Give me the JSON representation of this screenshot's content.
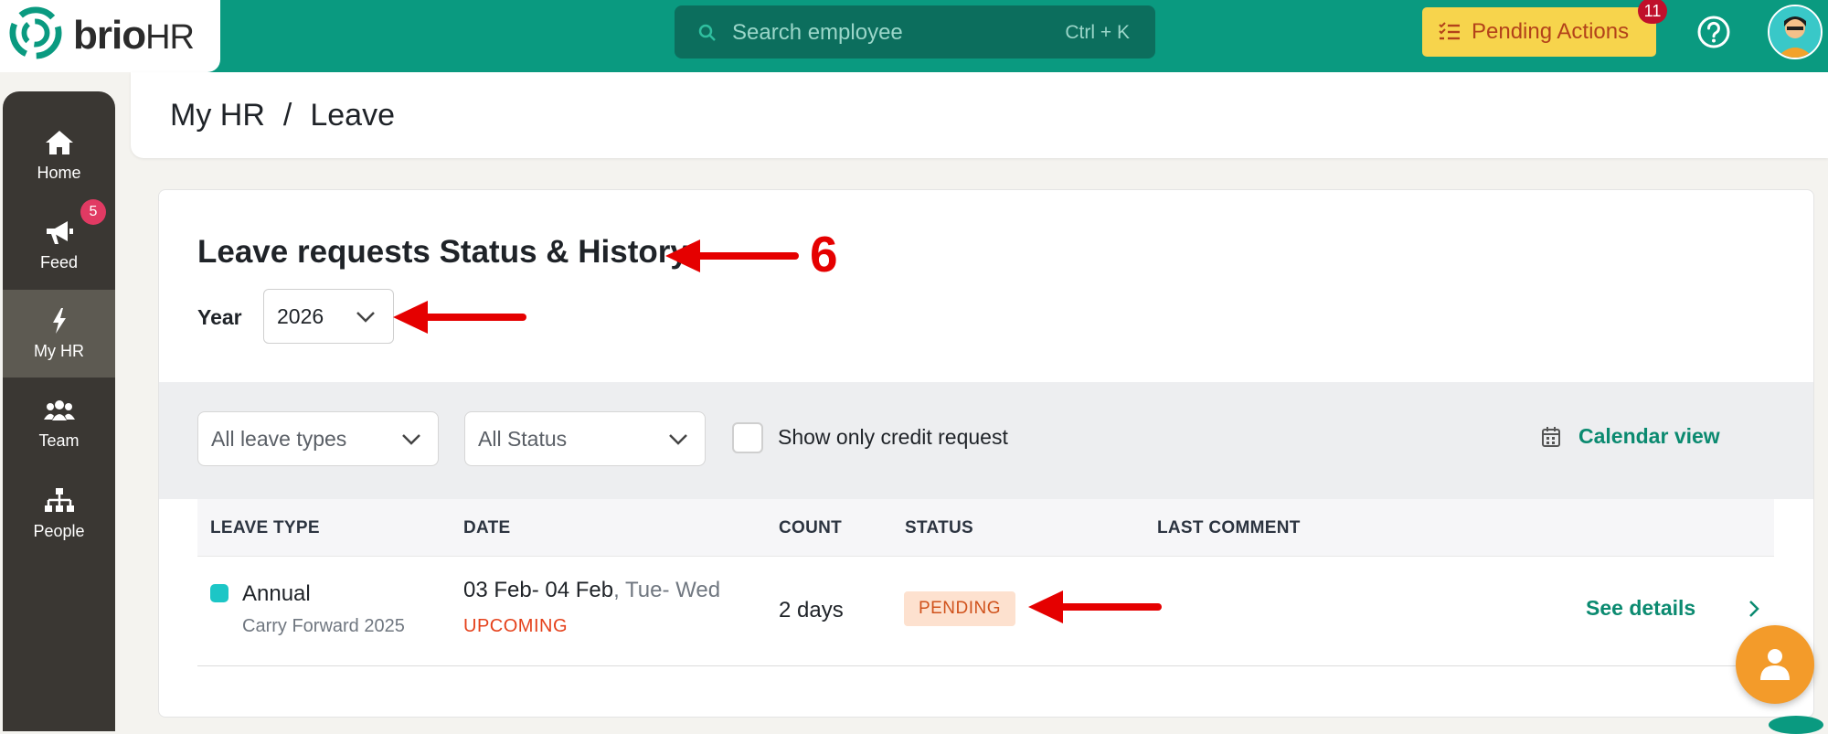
{
  "brand": {
    "name": "brio",
    "suffix": "HR"
  },
  "search": {
    "placeholder": "Search employee",
    "shortcut": "Ctrl + K"
  },
  "pending_actions": {
    "label": "Pending Actions",
    "count": "11"
  },
  "sidebar": {
    "items": [
      {
        "label": "Home",
        "icon": "home-icon"
      },
      {
        "label": "Feed",
        "icon": "megaphone-icon",
        "badge": "5"
      },
      {
        "label": "My HR",
        "icon": "lightning-icon",
        "active": true
      },
      {
        "label": "Team",
        "icon": "team-icon"
      },
      {
        "label": "People",
        "icon": "org-chart-icon"
      }
    ]
  },
  "breadcrumb": {
    "parent": "My HR",
    "separator": "/",
    "current": "Leave"
  },
  "section": {
    "title": "Leave requests Status & History",
    "year_label": "Year",
    "year_value": "2026"
  },
  "filters": {
    "leave_type": "All leave types",
    "status": "All Status",
    "credit_checkbox_label": "Show only credit request",
    "calendar_link": "Calendar view"
  },
  "table": {
    "columns": [
      "LEAVE TYPE",
      "DATE",
      "COUNT",
      "STATUS",
      "LAST COMMENT"
    ],
    "rows": [
      {
        "leave_type": "Annual",
        "leave_sub": "Carry Forward 2025",
        "date_range": "03 Feb- 04 Feb",
        "date_days": ", Tue- Wed",
        "date_tag": "UPCOMING",
        "count": "2 days",
        "status": "PENDING",
        "last_comment": "",
        "action": "See details"
      }
    ]
  },
  "annotation": {
    "step_number": "6"
  },
  "colors": {
    "brand_teal": "#0a9a80",
    "accent_green": "#0b8a70",
    "pending_yellow": "#f7d44c",
    "arrow_red": "#e50000"
  }
}
